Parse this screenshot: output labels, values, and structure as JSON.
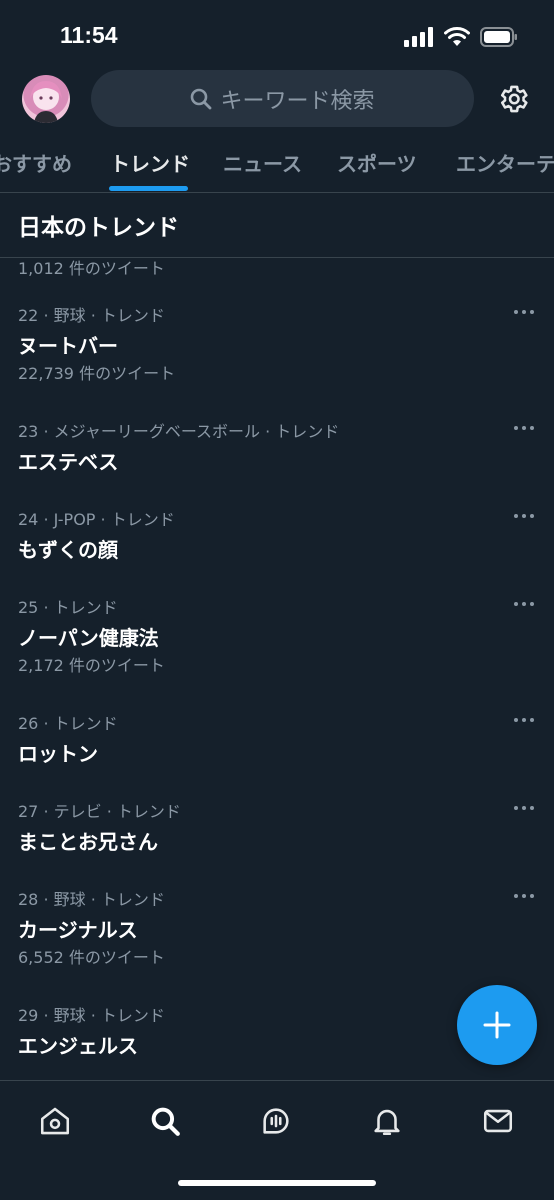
{
  "status_bar": {
    "time": "11:54"
  },
  "header": {
    "search_placeholder": "キーワード検索"
  },
  "tabs": [
    {
      "label": "おすすめ",
      "active": false
    },
    {
      "label": "トレンド",
      "active": true
    },
    {
      "label": "ニュース",
      "active": false
    },
    {
      "label": "スポーツ",
      "active": false
    },
    {
      "label": "エンターテ",
      "active": false
    }
  ],
  "section": {
    "title": "日本のトレンド"
  },
  "partial_trend": {
    "count": "1,012 件のツイート"
  },
  "trends": [
    {
      "meta": "22 · 野球 · トレンド",
      "name": "ヌートバー",
      "count": "22,739 件のツイート"
    },
    {
      "meta": "23 · メジャーリーグベースボール · トレンド",
      "name": "エステベス",
      "count": ""
    },
    {
      "meta": "24 · J-POP · トレンド",
      "name": "もずくの顔",
      "count": ""
    },
    {
      "meta": "25 · トレンド",
      "name": "ノーパン健康法",
      "count": "2,172 件のツイート"
    },
    {
      "meta": "26 · トレンド",
      "name": "ロットン",
      "count": ""
    },
    {
      "meta": "27 · テレビ · トレンド",
      "name": "まことお兄さん",
      "count": ""
    },
    {
      "meta": "28 · 野球 · トレンド",
      "name": "カージナルス",
      "count": "6,552 件のツイート"
    },
    {
      "meta": "29 · 野球 · トレンド",
      "name": "エンジェルス",
      "count": ""
    }
  ],
  "bottom_nav": [
    {
      "icon": "home-icon"
    },
    {
      "icon": "search-icon"
    },
    {
      "icon": "spaces-icon"
    },
    {
      "icon": "notifications-icon"
    },
    {
      "icon": "messages-icon"
    }
  ],
  "colors": {
    "background": "#15202b",
    "accent": "#1d9bf0",
    "secondary_text": "#8b98a5"
  }
}
